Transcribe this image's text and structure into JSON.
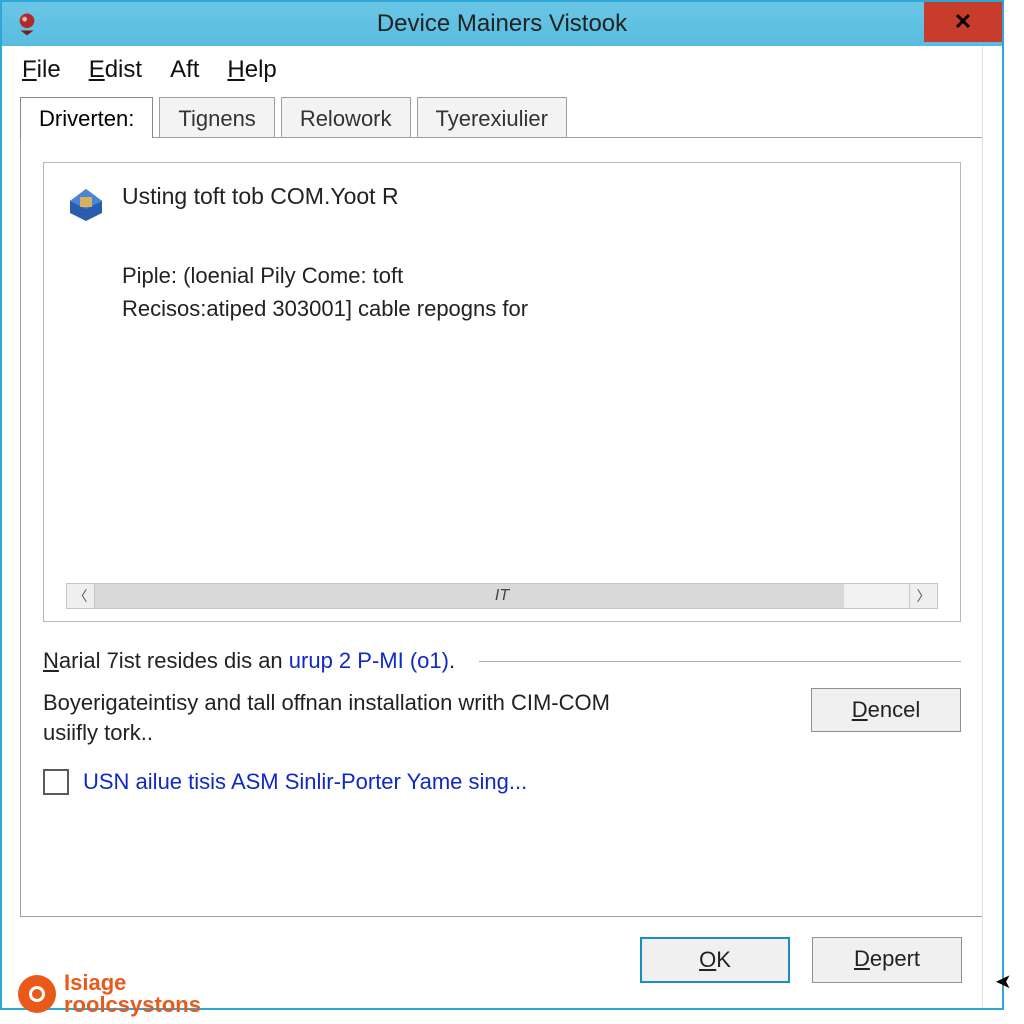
{
  "titlebar": {
    "title": "Device Mainers Vistook",
    "close_glyph": "✕"
  },
  "menu": {
    "file": "File",
    "edist": "Edist",
    "aft": "Aft",
    "help": "Help"
  },
  "tabs": {
    "driverten": "Driverten:",
    "tignens": "Tignens",
    "relowork": "Relowork",
    "tyerexiulier": "Tyerexiulier"
  },
  "device": {
    "title": "Usting toft tob COM.Yoot R",
    "piple_label": "Piple: (loenial ",
    "piple_mid_u": "P",
    "piple_mid": "ily Come: toft",
    "recisos": "Recisos:atiped 303001] cable repogns for",
    "scroll_label": "IT"
  },
  "narial": {
    "prefix_u": "N",
    "prefix": "arial 7ist resides dis an ",
    "link": "urup 2 P-MI (o1)",
    "suffix": "."
  },
  "boyer": {
    "desc": "Boyerigateintisy and tall offnan installation writh CIM-COM usiifly tork..",
    "dencel": "Dencel"
  },
  "usn": {
    "text": "USN ailue tisis ASM Sinlir-Porter Yame sing..."
  },
  "footer": {
    "ok": "OK",
    "depert": "Depert"
  },
  "watermark": {
    "line1": "Isiage",
    "line2": "roolcsystons"
  }
}
